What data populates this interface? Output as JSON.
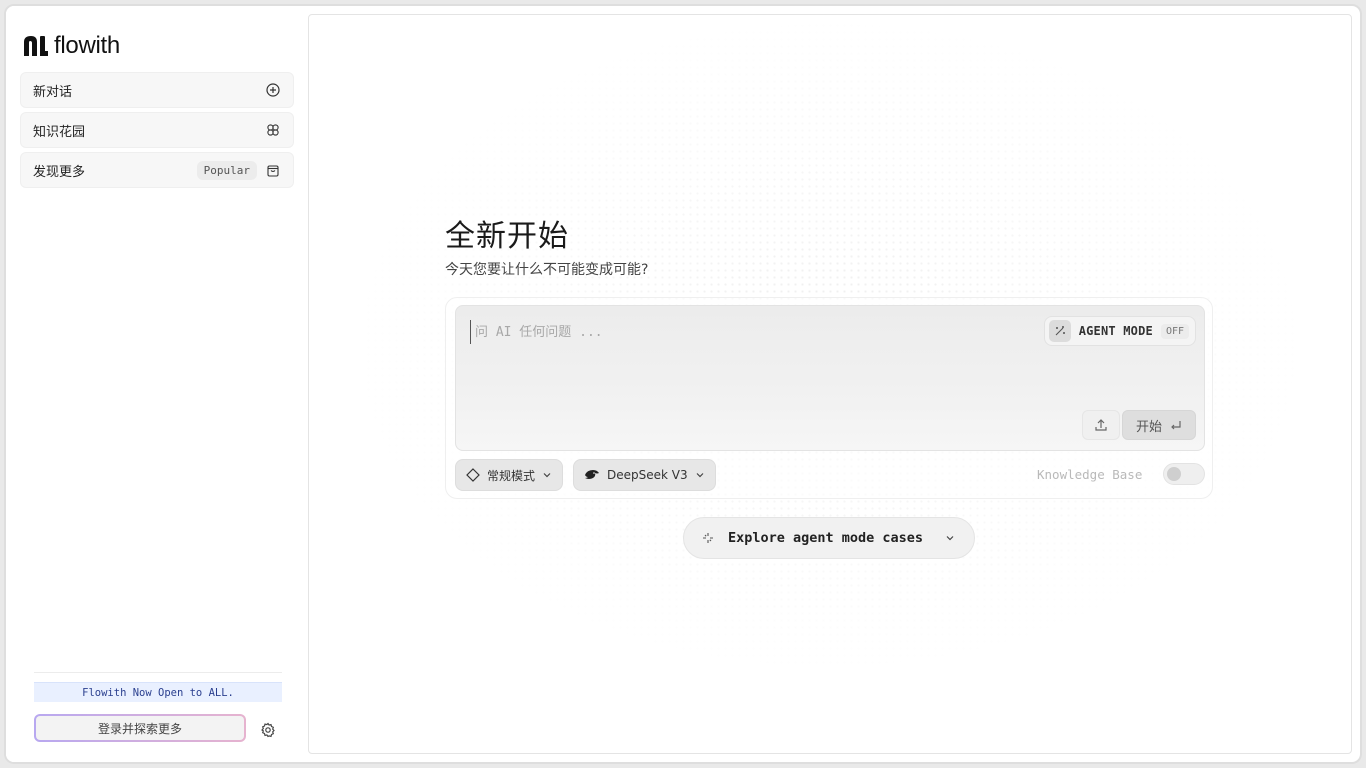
{
  "app": {
    "logo_text": "flowith"
  },
  "sidebar": {
    "items": [
      {
        "label": "新对话",
        "icon": "plus-circle-icon"
      },
      {
        "label": "知识花园",
        "icon": "flower-icon"
      },
      {
        "label": "发现更多",
        "badge": "Popular",
        "icon": "shopping-bag-icon"
      }
    ],
    "announcement": "Flowith Now Open to ALL.",
    "login_label": "登录并探索更多",
    "settings_icon": "gear-icon"
  },
  "main": {
    "title": "全新开始",
    "subtitle": "今天您要让什么不可能变成可能?",
    "composer": {
      "placeholder": "问 AI 任何问题 ...",
      "value": "",
      "agent_mode_label": "AGENT MODE",
      "agent_mode_state": "OFF",
      "upload_icon": "upload-icon",
      "start_label": "开始",
      "enter_icon": "enter-icon"
    },
    "mode_select": {
      "label": "常规模式",
      "icon": "diamond-icon"
    },
    "model_select": {
      "label": "DeepSeek V3",
      "icon": "deepseek-whale-icon"
    },
    "knowledge_base": {
      "label": "Knowledge Base",
      "enabled": false
    },
    "explore_label": "Explore agent mode cases"
  },
  "colors": {
    "accent_announce_bg": "#e9f0ff",
    "accent_announce_text": "#2a3f8f",
    "login_border_gradient": [
      "#b8a8f0",
      "#e6b3cf"
    ]
  }
}
